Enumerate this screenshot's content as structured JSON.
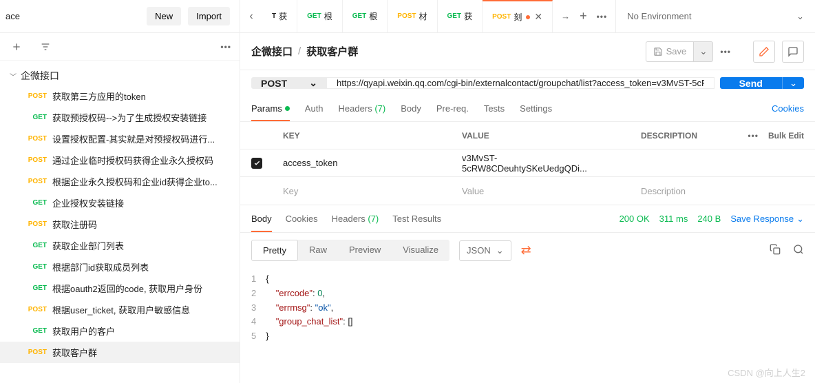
{
  "sidebar": {
    "workspace_suffix": "ace",
    "new_btn": "New",
    "import_btn": "Import",
    "collection": "企微接口",
    "items": [
      {
        "method": "POST",
        "label": "获取第三方应用的token",
        "cls": "m-post"
      },
      {
        "method": "GET",
        "label": "获取预授权码-->为了生成授权安装链接",
        "cls": "m-get"
      },
      {
        "method": "POST",
        "label": "设置授权配置-其实就是对预授权码进行...",
        "cls": "m-post"
      },
      {
        "method": "POST",
        "label": "通过企业临时授权码获得企业永久授权码",
        "cls": "m-post"
      },
      {
        "method": "POST",
        "label": "根据企业永久授权码和企业id获得企业to...",
        "cls": "m-post"
      },
      {
        "method": "GET",
        "label": "企业授权安装链接",
        "cls": "m-get"
      },
      {
        "method": "POST",
        "label": "获取注册码",
        "cls": "m-post"
      },
      {
        "method": "GET",
        "label": "获取企业部门列表",
        "cls": "m-get"
      },
      {
        "method": "GET",
        "label": "根据部门id获取成员列表",
        "cls": "m-get"
      },
      {
        "method": "GET",
        "label": "根据oauth2返回的code, 获取用户身份",
        "cls": "m-get"
      },
      {
        "method": "POST",
        "label": "根据user_ticket, 获取用户敏感信息",
        "cls": "m-post"
      },
      {
        "method": "GET",
        "label": "获取用户的客户",
        "cls": "m-get"
      },
      {
        "method": "POST",
        "label": "获取客户群",
        "cls": "m-post",
        "selected": true
      }
    ]
  },
  "tabs": [
    {
      "method": "T",
      "label": "获",
      "cls": ""
    },
    {
      "method": "GET",
      "label": "根",
      "cls": "m-get"
    },
    {
      "method": "GET",
      "label": "根",
      "cls": "m-get"
    },
    {
      "method": "POST",
      "label": "材",
      "cls": "m-post"
    },
    {
      "method": "GET",
      "label": "获",
      "cls": "m-get"
    },
    {
      "method": "POST",
      "label": "刻",
      "cls": "m-post",
      "active": true,
      "dot": true,
      "close": true
    }
  ],
  "environment": "No Environment",
  "breadcrumb": {
    "parent": "企微接口",
    "current": "获取客户群"
  },
  "save_label": "Save",
  "request": {
    "method": "POST",
    "url": "https://qyapi.weixin.qq.com/cgi-bin/externalcontact/groupchat/list?access_token=v3MvST-5cR"
  },
  "req_tabs": {
    "params": "Params",
    "auth": "Auth",
    "headers": "Headers",
    "headers_count": "(7)",
    "body": "Body",
    "prereq": "Pre-req.",
    "tests": "Tests",
    "settings": "Settings",
    "cookies": "Cookies"
  },
  "params_header": {
    "key": "KEY",
    "value": "VALUE",
    "desc": "DESCRIPTION",
    "bulk": "Bulk Edit"
  },
  "params_rows": [
    {
      "key": "access_token",
      "value": "v3MvST-5cRW8CDeuhtySKeUedgQDi..."
    }
  ],
  "params_placeholder": {
    "key": "Key",
    "value": "Value",
    "desc": "Description"
  },
  "resp_tabs": {
    "body": "Body",
    "cookies": "Cookies",
    "headers": "Headers",
    "headers_count": "(7)",
    "tests": "Test Results"
  },
  "resp_status": {
    "code": "200 OK",
    "time": "311 ms",
    "size": "240 B",
    "save": "Save Response"
  },
  "body_modes": {
    "pretty": "Pretty",
    "raw": "Raw",
    "preview": "Preview",
    "visualize": "Visualize",
    "fmt": "JSON"
  },
  "json_lines": [
    "{",
    "    \"errcode\": 0,",
    "    \"errmsg\": \"ok\",",
    "    \"group_chat_list\": []",
    "}"
  ],
  "watermark": "CSDN @向上人生2"
}
